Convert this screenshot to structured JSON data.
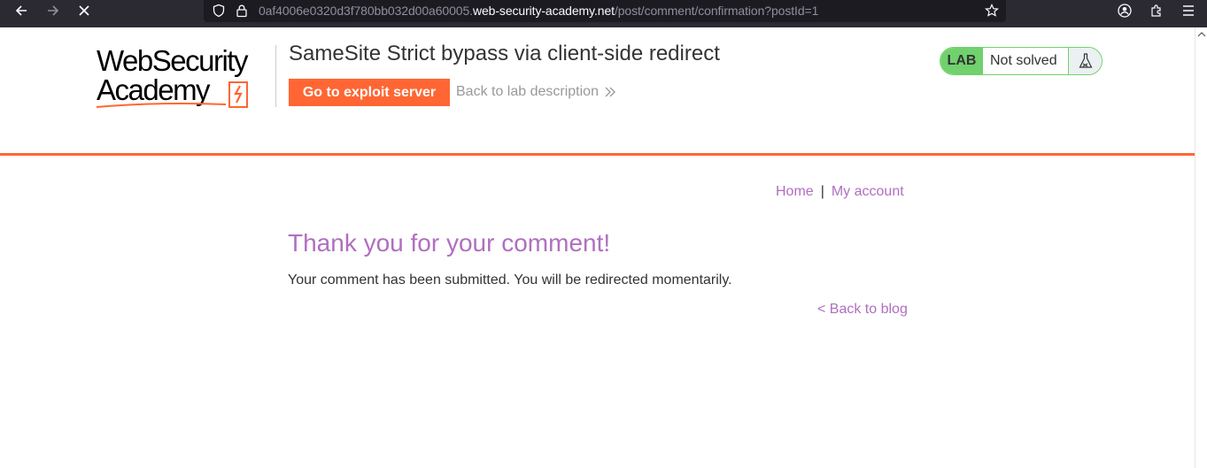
{
  "browser": {
    "url_prefix": "0af4006e0320d3f780bb032d00a60005.",
    "url_host": "web-security-academy.net",
    "url_path": "/post/comment/confirmation?postId=1",
    "icons": [
      "back-arrow-icon",
      "forward-arrow-icon",
      "stop-loading-icon",
      "shield-icon",
      "lock-icon",
      "bookmark-star-icon",
      "account-icon",
      "extensions-icon",
      "menu-icon"
    ]
  },
  "header": {
    "logo_line1": "WebSecurity",
    "logo_line2": "Academy",
    "lab_title": "SameSite Strict bypass via client-side redirect",
    "exploit_button": "Go to exploit server",
    "back_to_lab": "Back to lab description",
    "lab_badge": "LAB",
    "lab_state": "Not solved"
  },
  "nav": {
    "home": "Home",
    "separator": "|",
    "my_account": "My account"
  },
  "main": {
    "heading": "Thank you for your comment!",
    "message": "Your comment has been submitted. You will be redirected momentarily.",
    "back_to_blog": "< Back to blog"
  },
  "colors": {
    "accent": "#ff6633",
    "link": "#b06fbf",
    "lab_green": "#70d16d",
    "browser_chrome": "#2b2a33"
  }
}
